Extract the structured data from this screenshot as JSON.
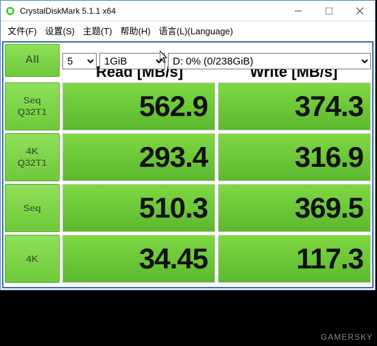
{
  "title": "CrystalDiskMark 5.1.1 x64",
  "menu": {
    "file": "文件(F)",
    "settings": "设置(S)",
    "theme": "主题(T)",
    "help": "帮助(H)",
    "language": "语言(L)(Language)"
  },
  "buttons": {
    "all": "All"
  },
  "selects": {
    "runs": "5",
    "size": "1GiB",
    "drive": "D: 0% (0/238GiB)"
  },
  "headers": {
    "read": "Read [MB/s]",
    "write": "Write [MB/s]"
  },
  "rows": [
    {
      "label1": "Seq",
      "label2": "Q32T1",
      "read": "562.9",
      "write": "374.3"
    },
    {
      "label1": "4K",
      "label2": "Q32T1",
      "read": "293.4",
      "write": "316.9"
    },
    {
      "label1": "Seq",
      "label2": "",
      "read": "510.3",
      "write": "369.5"
    },
    {
      "label1": "4K",
      "label2": "",
      "read": "34.45",
      "write": "117.3"
    }
  ],
  "watermark": "GAMERSKY"
}
